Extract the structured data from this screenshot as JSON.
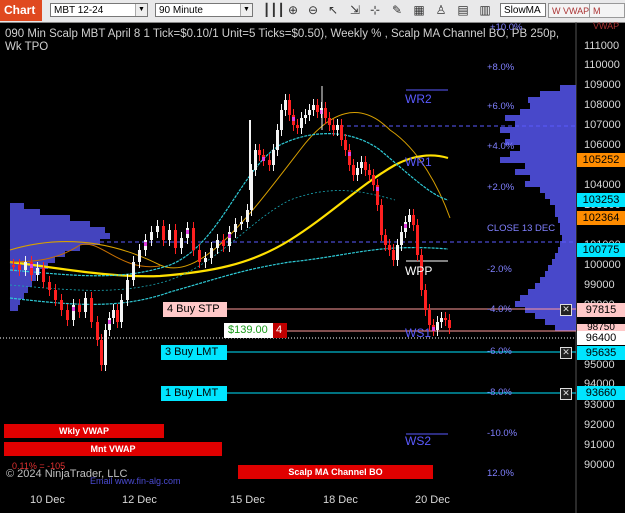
{
  "toolbar": {
    "chart_tab": "Chart",
    "instrument": "MBT 12-24",
    "interval": "90 Minute",
    "strategy_select": "SlowMA",
    "buttons": [
      "W VWAP",
      "M VWAP"
    ]
  },
  "header": {
    "title": "090 Min Scalp MBT April 8 1 Tick=$0.10/1 Unit=5 Ticks=$0.50), Weekly % , Scalp MA Channel BO, PB 250p, Wk TPO",
    "top_pct": "+10.0%"
  },
  "y_axis": {
    "labels": [
      "111000",
      "110000",
      "109000",
      "108000",
      "107000",
      "106000",
      "104000",
      "103000",
      "101000",
      "100000",
      "99000",
      "98000",
      "95000",
      "94000",
      "93000",
      "92000",
      "91000",
      "90000"
    ],
    "partial_labels": [
      "98750",
      "94000"
    ]
  },
  "x_axis": {
    "labels": [
      "10 Dec",
      "12 Dec",
      "15 Dec",
      "18 Dec",
      "20 Dec"
    ]
  },
  "price_boxes": [
    {
      "value": "105252",
      "bg": "#ff8c00"
    },
    {
      "value": "103253",
      "bg": "#00e5ff"
    },
    {
      "value": "102364",
      "bg": "#ff8c00"
    },
    {
      "value": "100775",
      "bg": "#00e5ff"
    },
    {
      "value": "97815",
      "bg": "#ffc8c8"
    },
    {
      "value": "98750",
      "bg": "#ffc8c8"
    },
    {
      "value": "96400",
      "bg": "#ffffff"
    },
    {
      "value": "95635",
      "bg": "#00e5ff"
    },
    {
      "value": "93660",
      "bg": "#00e5ff"
    }
  ],
  "pct_labels": [
    "+8.0%",
    "+6.0%",
    "+4.0%",
    "+2.0%",
    "CLOSE 13 DEC",
    "-2.0%",
    "-4.0%",
    "-6.0%",
    "-8.0%",
    "-10.0%",
    "12.0%"
  ],
  "pivots": [
    "WR2",
    "WR1",
    "WPP",
    "WS1",
    "WS2"
  ],
  "orders": {
    "buy_stp": "4 Buy STP",
    "position_price": "$139.00",
    "position_qty": "4",
    "buy_lmt_1": "3 Buy LMT",
    "buy_lmt_2": "1 Buy LMT"
  },
  "banners": {
    "wkly": "Wkly VWAP",
    "mnt": "Mnt VWAP",
    "scalp": "Scalp MA Channel BO"
  },
  "footer": {
    "copyright": "© 2024 NinjaTrader, LLC",
    "url": "Email   www.fin-alg.com",
    "pct_red": "0.11% = -105"
  },
  "colors": {
    "chart_tab": "#e0491f",
    "bull": "#f4f4f4",
    "bear": "#ff2020",
    "profile": "#5050e0",
    "wvwap": "#ffe000",
    "channel": "#2ecad6",
    "order_stp": "#ffc8c8",
    "order_lmt": "#00e5ff"
  }
}
